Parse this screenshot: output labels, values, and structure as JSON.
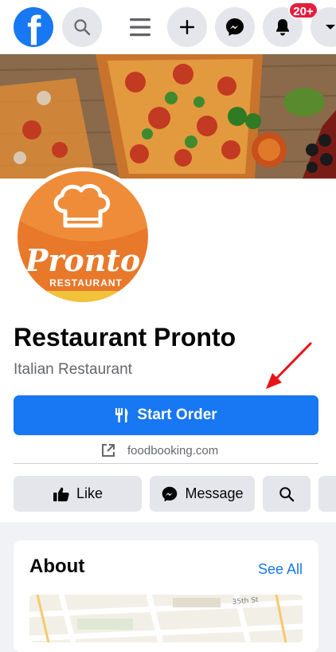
{
  "topbar": {
    "logo_letter": "f",
    "notifications_badge": "20+",
    "icons": [
      "facebook-logo",
      "search-icon",
      "menu-icon",
      "plus-icon",
      "messenger-icon",
      "bell-icon",
      "chevron-down-icon"
    ]
  },
  "page": {
    "name": "Restaurant Pronto",
    "category": "Italian Restaurant",
    "logo_script": "Pronto",
    "logo_sub": "RESTAURANT"
  },
  "primary_action": {
    "label": "Start Order",
    "icon": "utensils-icon"
  },
  "website": {
    "text": "foodbooking.com",
    "icon": "external-link-icon"
  },
  "actions": [
    {
      "label": "Like",
      "icon": "thumbs-up-icon"
    },
    {
      "label": "Message",
      "icon": "messenger-icon"
    },
    {
      "label": "",
      "icon": "search-icon"
    }
  ],
  "about": {
    "title": "About",
    "see_all": "See All",
    "map_street_label": "35th St"
  },
  "colors": {
    "brand_blue": "#1877f2",
    "badge_red": "#e41e3f",
    "annotation_arrow": "#e8141a",
    "logo_orange": "#e8782a"
  }
}
